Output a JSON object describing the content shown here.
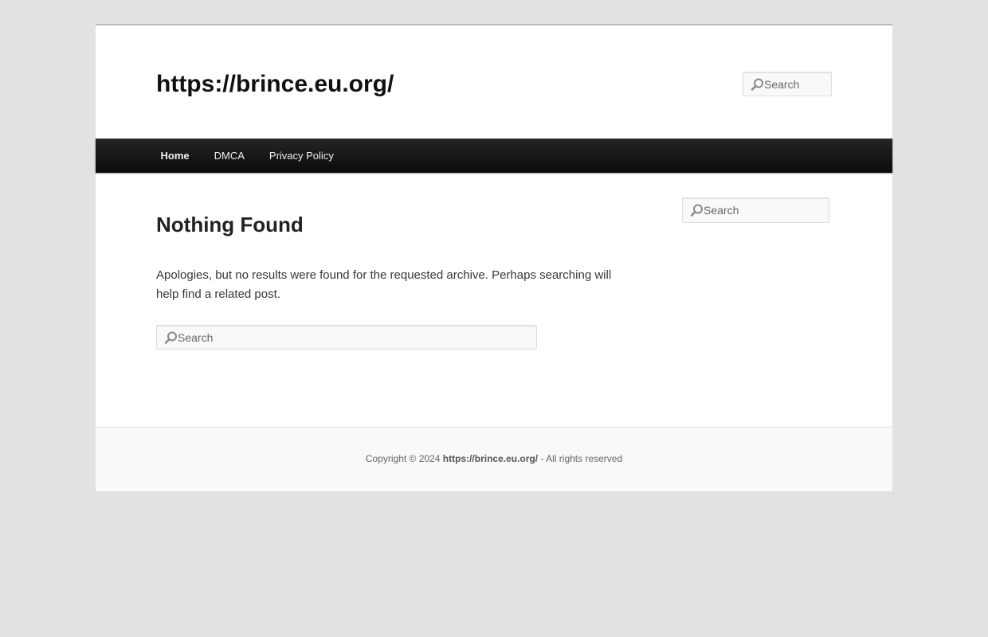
{
  "header": {
    "site_title": "https://brince.eu.org/",
    "search_placeholder": "Search"
  },
  "nav": {
    "items": [
      {
        "label": "Home"
      },
      {
        "label": "DMCA"
      },
      {
        "label": "Privacy Policy"
      }
    ]
  },
  "main": {
    "title": "Nothing Found",
    "message": "Apologies, but no results were found for the requested archive. Perhaps searching will help find a related post.",
    "search_placeholder": "Search"
  },
  "sidebar": {
    "search_placeholder": "Search"
  },
  "footer": {
    "copyright_prefix": "Copyright © 2024",
    "site_link": "https://brince.eu.org/",
    "suffix": "- All rights reserved"
  },
  "icons": {
    "search": "search-icon"
  }
}
